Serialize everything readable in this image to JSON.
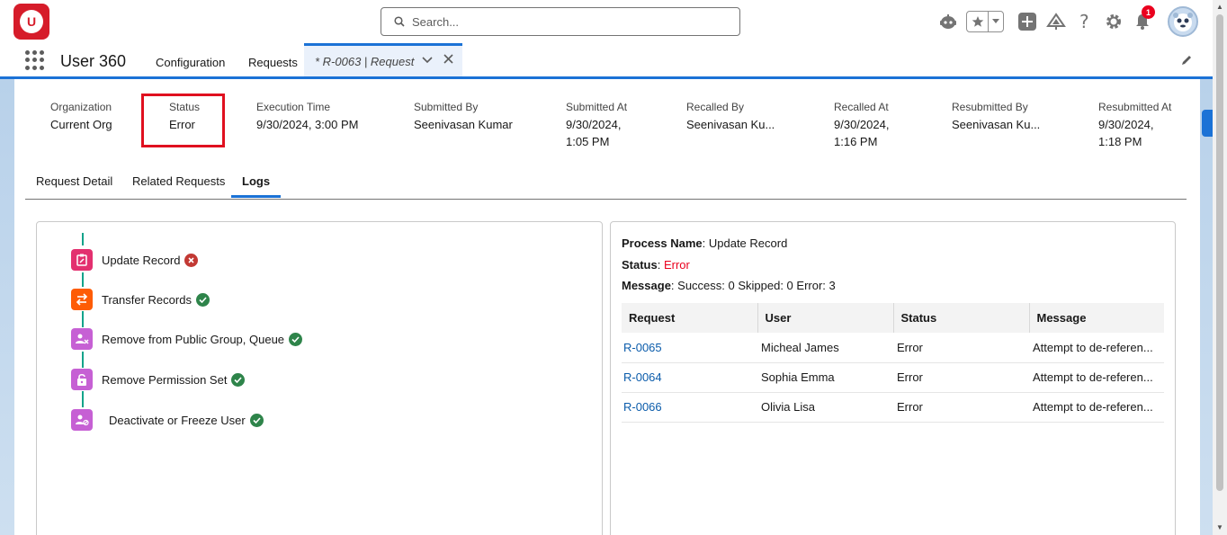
{
  "header": {
    "logo_text": "U",
    "search_placeholder": "Search...",
    "notification_count": "1"
  },
  "nav": {
    "app_name": "User 360",
    "items": [
      {
        "label": "Configuration"
      },
      {
        "label": "Requests"
      }
    ],
    "active_tab": "* R-0063 | Request"
  },
  "record": {
    "fields": [
      {
        "label": "Organization",
        "value": "Current Org"
      },
      {
        "label": "Status",
        "value": "Error"
      },
      {
        "label": "Execution Time",
        "value": "9/30/2024, 3:00 PM"
      },
      {
        "label": "Submitted By",
        "value": "Seenivasan Kumar"
      },
      {
        "label": "Submitted At",
        "value": "9/30/2024,",
        "value2": "1:05 PM"
      },
      {
        "label": "Recalled By",
        "value": "Seenivasan Ku..."
      },
      {
        "label": "Recalled At",
        "value": "9/30/2024,",
        "value2": "1:16 PM"
      },
      {
        "label": "Resubmitted By",
        "value": "Seenivasan Ku..."
      },
      {
        "label": "Resubmitted At",
        "value": "9/30/2024,",
        "value2": "1:18 PM"
      }
    ]
  },
  "tabs": [
    {
      "label": "Request Detail"
    },
    {
      "label": "Related Requests"
    },
    {
      "label": "Logs"
    }
  ],
  "steps": [
    {
      "label": "Update Record",
      "status": "error",
      "color": "#e3306f"
    },
    {
      "label": "Transfer Records",
      "status": "success",
      "color": "#fe5c05"
    },
    {
      "label": "Remove from Public Group, Queue",
      "status": "success",
      "color": "#c660d4"
    },
    {
      "label": "Remove Permission Set",
      "status": "success",
      "color": "#c660d4"
    },
    {
      "label": "Deactivate or Freeze User",
      "status": "success",
      "color": "#c660d4"
    }
  ],
  "process": {
    "name_label": "Process Name",
    "name": "Update Record",
    "status_label": "Status",
    "status": "Error",
    "message_label": "Message",
    "message": "Success: 0 Skipped: 0 Error: 3"
  },
  "table": {
    "headers": [
      "Request",
      "User",
      "Status",
      "Message"
    ],
    "rows": [
      [
        "R-0065",
        "Micheal James",
        "Error",
        "Attempt to de-referen..."
      ],
      [
        "R-0064",
        "Sophia Emma",
        "Error",
        "Attempt to de-referen..."
      ],
      [
        "R-0066",
        "Olivia Lisa",
        "Error",
        "Attempt to de-referen..."
      ]
    ]
  }
}
